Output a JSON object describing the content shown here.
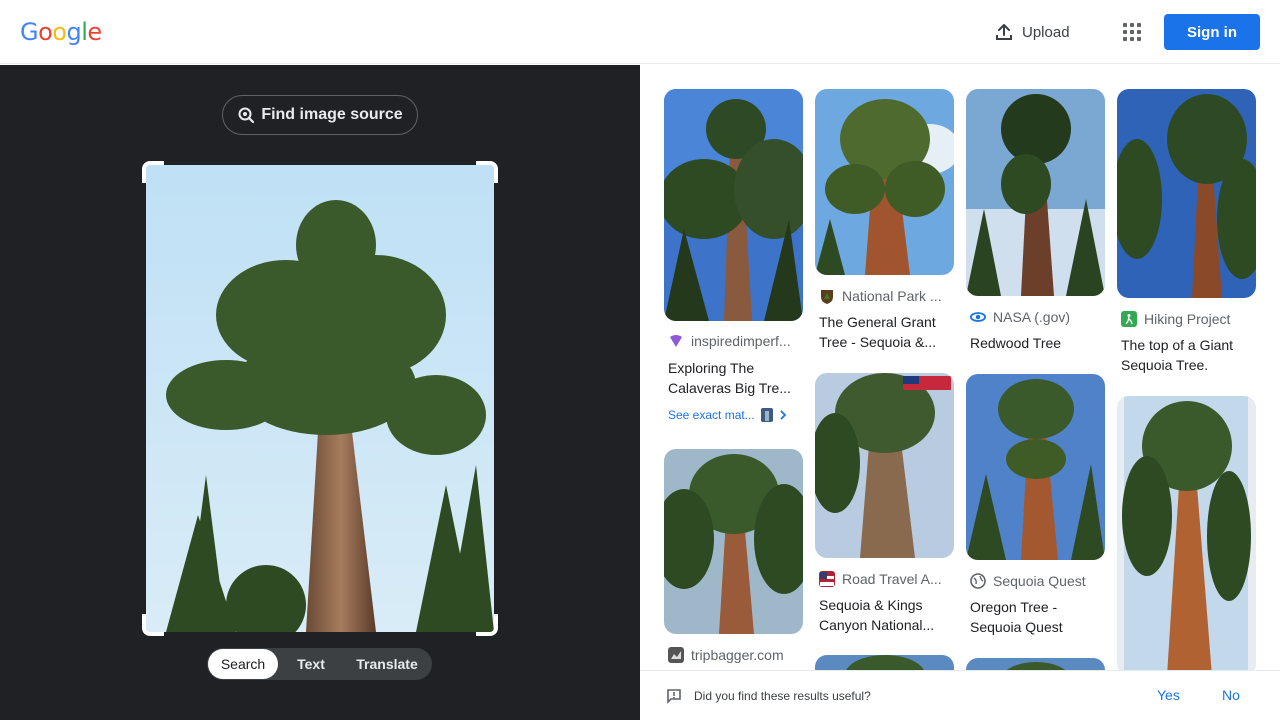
{
  "header": {
    "logo_letters": [
      "G",
      "o",
      "o",
      "g",
      "l",
      "e"
    ],
    "logo_colors": [
      "#4285f4",
      "#ea4335",
      "#fbbc05",
      "#4285f4",
      "#34a853",
      "#ea4335"
    ],
    "upload_label": "Upload",
    "signin_label": "Sign in",
    "accent": "#1a73e8"
  },
  "lens": {
    "find_source_label": "Find image source",
    "tabs": [
      {
        "label": "Search",
        "active": true
      },
      {
        "label": "Text",
        "active": false
      },
      {
        "label": "Translate",
        "active": false
      }
    ]
  },
  "results": [
    {
      "source": "inspiredimperf...",
      "title": "Exploring The Calaveras Big Tre...",
      "exact_label": "See exact mat...",
      "favicon_color": "#8e5ad8"
    },
    {
      "source": "tripbagger.com",
      "title": "",
      "favicon_color": "#555555"
    },
    {
      "source": "National Park ...",
      "title": "The General Grant Tree - Sequoia &...",
      "favicon_color": "#5a3e1b"
    },
    {
      "source": "Road Travel A...",
      "title": "Sequoia & Kings Canyon National...",
      "favicon_color": "#b22234"
    },
    {
      "source": "NASA (.gov)",
      "title": "Redwood Tree",
      "favicon_color": "#1a73e8"
    },
    {
      "source": "Sequoia Quest",
      "title": "Oregon Tree - Sequoia Quest",
      "favicon_color": "#5f6368"
    },
    {
      "source": "Hiking Project",
      "title": "The top of a Giant Sequoia Tree.",
      "favicon_color": "#34a853"
    }
  ],
  "feedback": {
    "question": "Did you find these results useful?",
    "yes_label": "Yes",
    "no_label": "No"
  }
}
